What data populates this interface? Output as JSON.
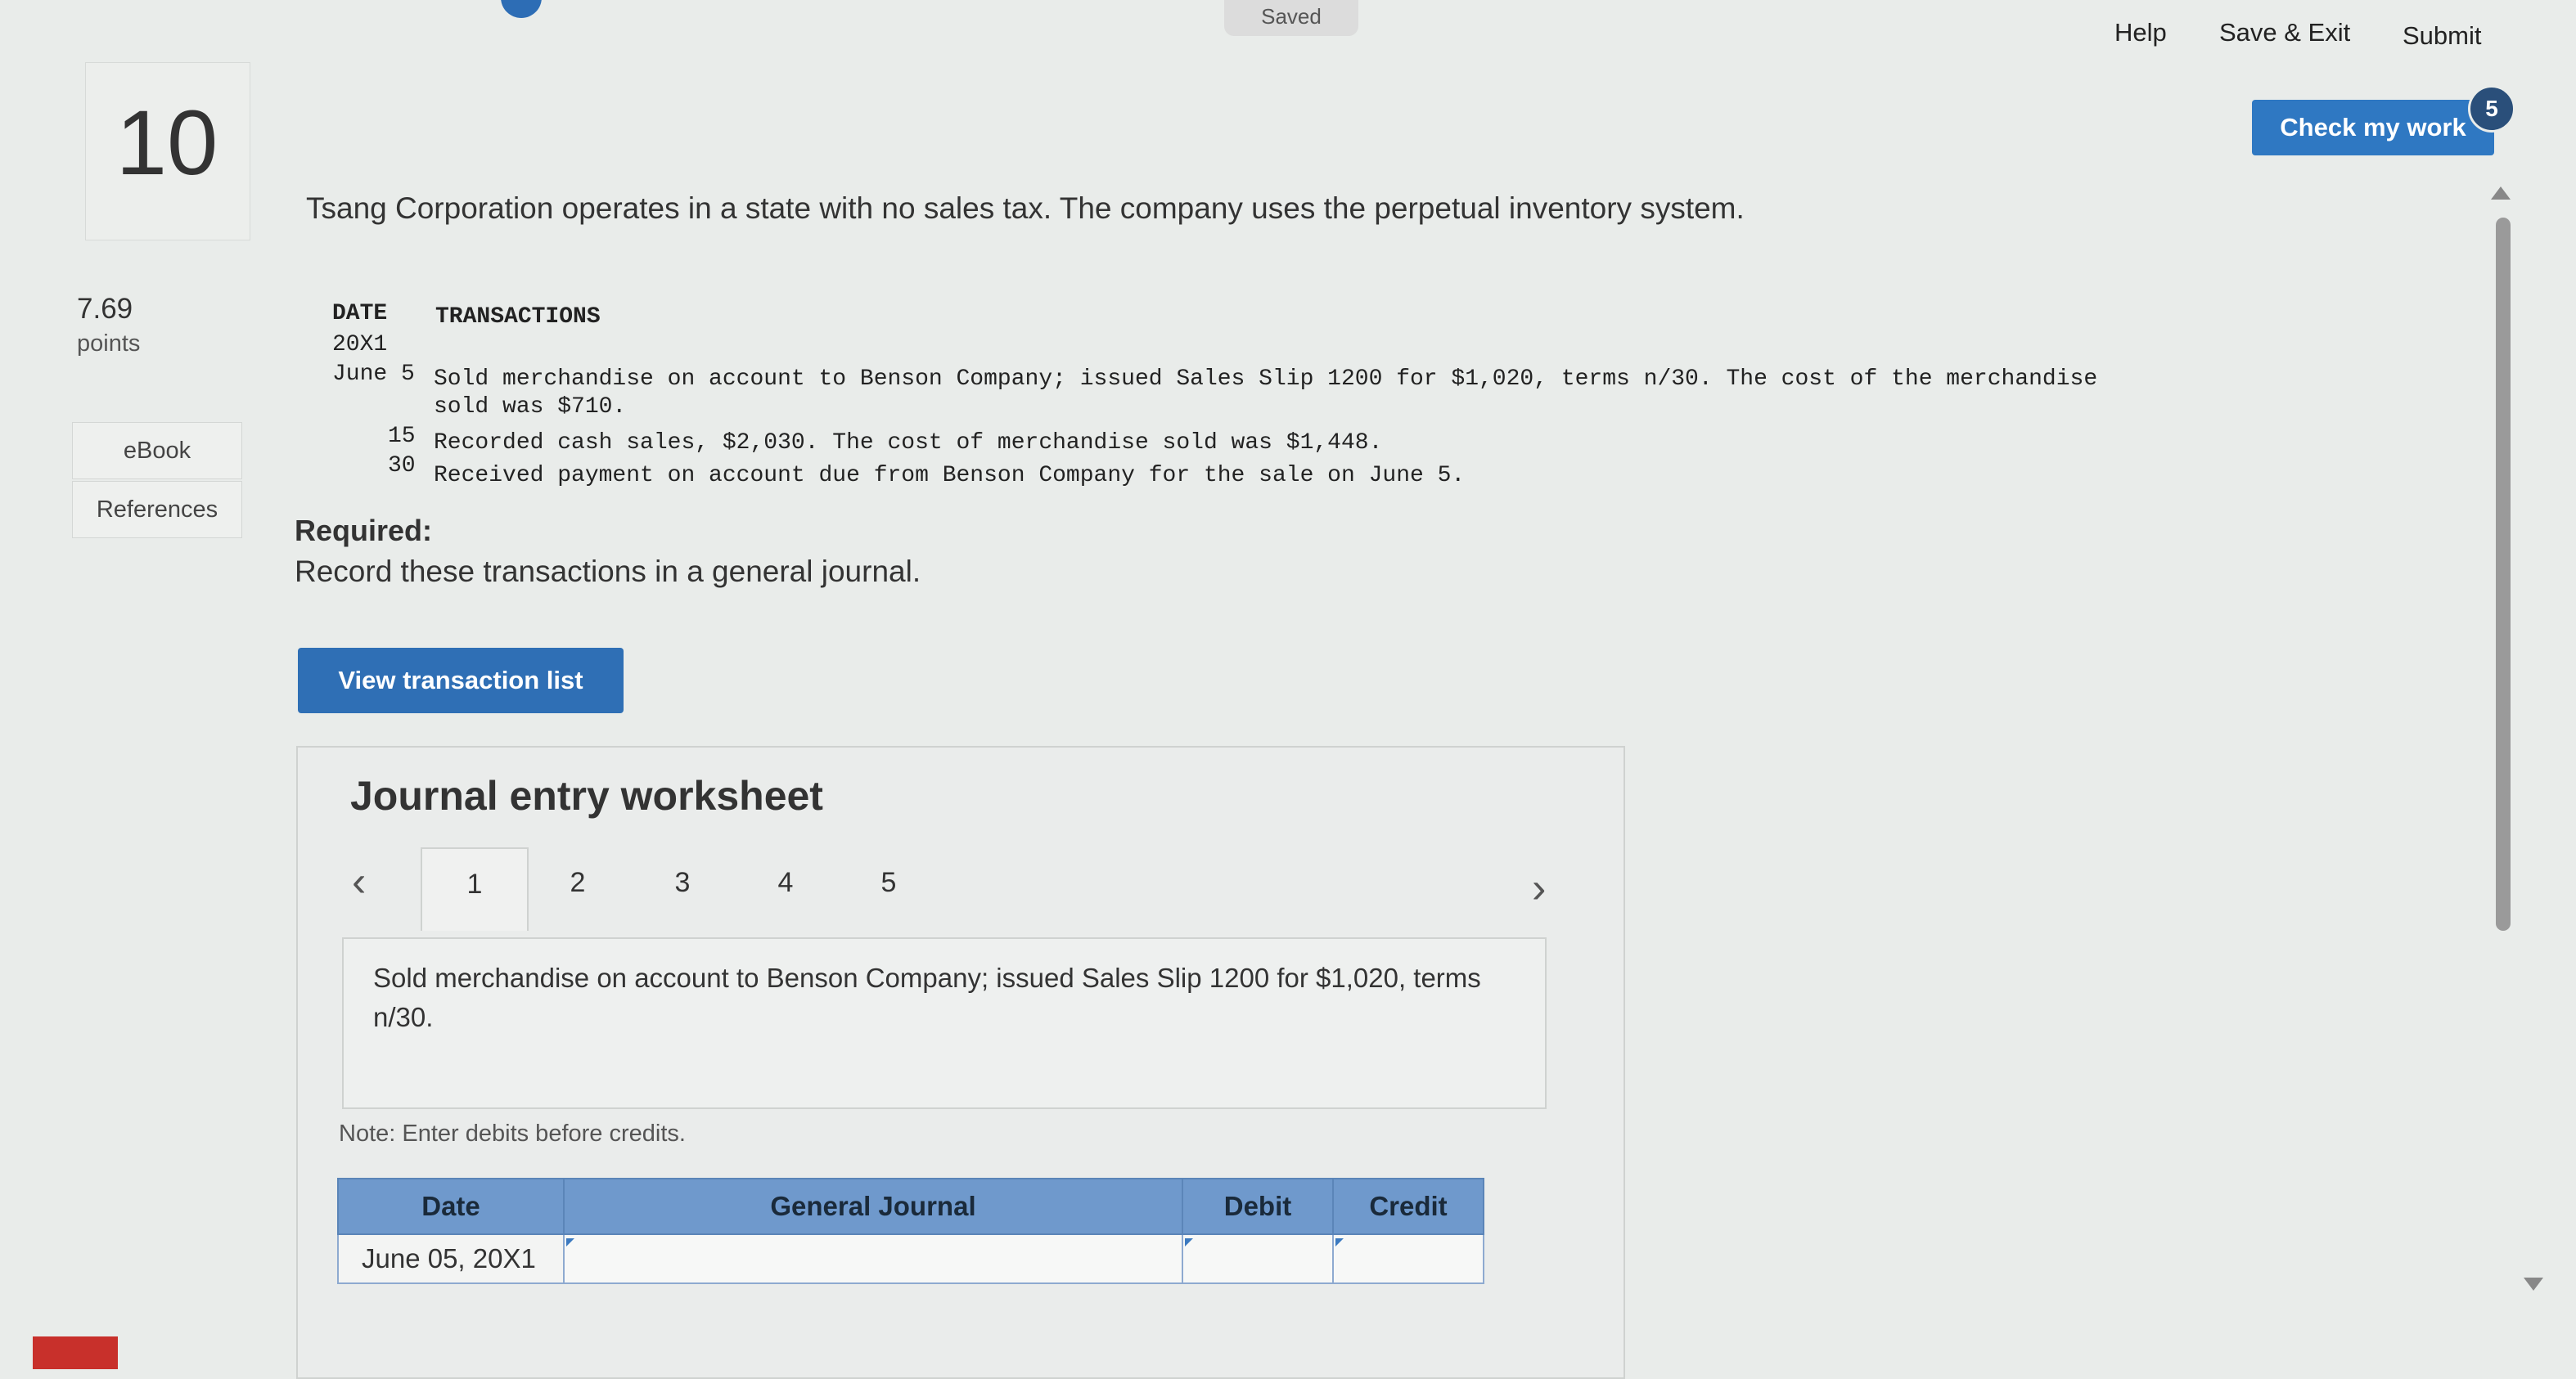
{
  "header": {
    "saved_label": "Saved",
    "help_label": "Help",
    "save_exit_label": "Save & Exit",
    "submit_label": "Submit"
  },
  "check_work": {
    "label": "Check my work",
    "badge": "5"
  },
  "question": {
    "number": "10",
    "points_value": "7.69",
    "points_label": "points",
    "ebook_label": "eBook",
    "references_label": "References",
    "intro": "Tsang Corporation operates in a state with no sales tax. The company uses the perpetual inventory system.",
    "tx_header_date": "DATE",
    "tx_header_transactions": "TRANSACTIONS",
    "tx_year": "20X1",
    "tx1_day": "June 5",
    "tx1_text": "Sold merchandise on account to Benson Company; issued Sales Slip 1200 for $1,020, terms n/30. The cost of the merchandise",
    "tx1_text_cont": "sold was $710.",
    "tx2_day": "15",
    "tx2_text": "Recorded cash sales, $2,030. The cost of merchandise sold was $1,448.",
    "tx3_day": "30",
    "tx3_text": "Received payment on account due from Benson Company for the sale on June 5.",
    "required_heading": "Required:",
    "required_text": "Record these transactions in a general journal."
  },
  "view_transaction_label": "View transaction list",
  "worksheet": {
    "title": "Journal entry worksheet",
    "tabs": [
      {
        "label": "1",
        "active": true
      },
      {
        "label": "2"
      },
      {
        "label": "3"
      },
      {
        "label": "4"
      },
      {
        "label": "5"
      }
    ],
    "description": "Sold merchandise on account to Benson Company; issued Sales Slip 1200 for $1,020, terms n/30.",
    "note": "Note: Enter debits before credits.",
    "table": {
      "headers": [
        "Date",
        "General Journal",
        "Debit",
        "Credit"
      ],
      "rows": [
        {
          "date": "June 05, 20X1",
          "general_journal": "",
          "debit": "",
          "credit": ""
        }
      ]
    }
  }
}
